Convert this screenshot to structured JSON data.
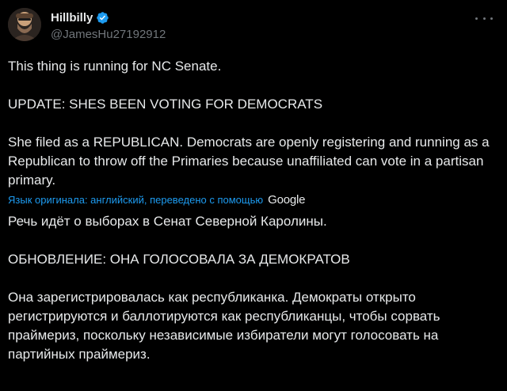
{
  "author": {
    "display_name": "Hillbilly",
    "handle": "@JamesHu27192912",
    "verified": true
  },
  "colors": {
    "background": "#000000",
    "text": "#e7e9ea",
    "muted": "#71767b",
    "accent": "#1d9bf0"
  },
  "icons": {
    "verified": "verified-badge-icon",
    "more": "more-options-icon"
  },
  "tweet": {
    "original": [
      "This thing is running for NC Senate.",
      "UPDATE: SHES BEEN VOTING FOR DEMOCRATS",
      "She filed as a REPUBLICAN. Democrats are openly registering and running as a Republican to throw off the Primaries because unaffiliated can vote in a partisan primary."
    ],
    "translation_note": "Язык оригинала: английский, переведено с помощью",
    "translation_provider": "Google",
    "translated": [
      "Речь идёт о выборах в Сенат Северной Каролины.",
      "ОБНОВЛЕНИЕ: ОНА ГОЛОСОВАЛА ЗА ДЕМОКРАТОВ",
      "Она зарегистрировалась как республиканка. Демократы открыто регистрируются и баллотируются как республиканцы, чтобы сорвать праймериз, поскольку независимые избиратели могут голосовать на партийных праймериз."
    ]
  }
}
